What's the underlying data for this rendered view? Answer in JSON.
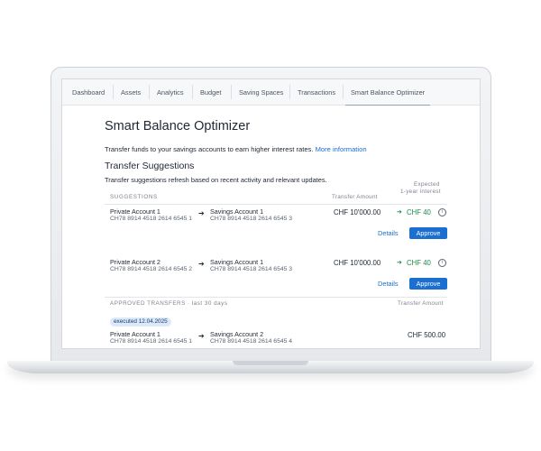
{
  "nav": {
    "tabs": [
      {
        "label": "Dashboard"
      },
      {
        "label": "Assets"
      },
      {
        "label": "Analytics"
      },
      {
        "label": "Budget"
      },
      {
        "label": "Saving Spaces"
      },
      {
        "label": "Transactions"
      },
      {
        "label": "Smart Balance Optimizer",
        "active": true
      }
    ]
  },
  "page": {
    "title": "Smart Balance Optimizer",
    "intro": "Transfer funds to your savings accounts to earn higher interest rates.",
    "intro_link": "More information"
  },
  "transfer_suggestions": {
    "title": "Transfer Suggestions",
    "subtitle": "Transfer suggestions refresh based on recent activity and relevant updates.",
    "headers": {
      "suggestions": "SUGGESTIONS",
      "transfer_amount": "Transfer Amount",
      "expected_line1": "Expected",
      "expected_line2": "1-year interest"
    },
    "rows": [
      {
        "from_name": "Private Account 1",
        "from_iban": "CH78 8914 4518 2614 6545 1",
        "to_name": "Savings Account 1",
        "to_iban": "CH78 8914 4518 2614 6545 3",
        "amount": "CHF 10'000.00",
        "interest": "CHF 40",
        "details": "Details",
        "approve": "Approve"
      },
      {
        "from_name": "Private Account 2",
        "from_iban": "CH78 8914 4518 2614 6545 2",
        "to_name": "Savings Account 1",
        "to_iban": "CH78 8914 4518 2614 6545 3",
        "amount": "CHF 10'000.00",
        "interest": "CHF 40",
        "details": "Details",
        "approve": "Approve"
      }
    ]
  },
  "approved_transfers": {
    "header": "APPROVED TRANSFERS · last 30 days",
    "amount_header": "Transfer Amount",
    "rows": [
      {
        "badge": "executed 12.04.2025",
        "from_name": "Private Account 1",
        "from_iban": "CH78 8914 4518 2614 6545 1",
        "to_name": "Savings Account 2",
        "to_iban": "CH78 8914 4518 2614 6545 4",
        "amount": "CHF 500.00"
      }
    ]
  },
  "icons": {
    "arrow": "arrow-right-icon",
    "info": "info-circle-icon"
  },
  "colors": {
    "accent": "#1a6fd1",
    "positive": "#1e8a4c",
    "badge_bg": "#dbe9fb"
  }
}
